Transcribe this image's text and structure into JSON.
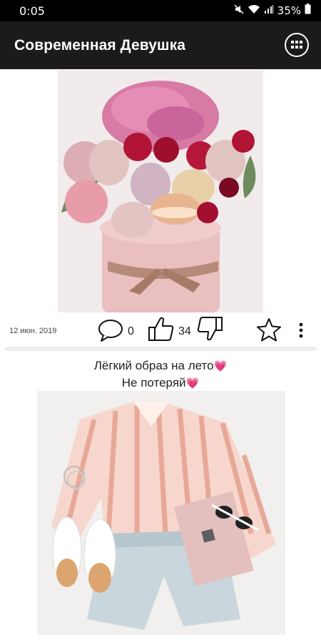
{
  "status_bar": {
    "time": "0:05",
    "battery": "35%"
  },
  "app_bar": {
    "title": "Современная Девушка",
    "menu_icon": "grid-menu-icon"
  },
  "posts": [
    {
      "date": "12 июн. 2019",
      "comments": "0",
      "likes": "34",
      "image": "flower-and-berry-bouquet-photo"
    },
    {
      "caption_line1": "Лёгкий образ на лето",
      "caption_line2": "Не потеряй",
      "emoji": "💗",
      "image": "summer-outfit-photo"
    }
  ],
  "colors": {
    "appbar": "#1b1b1b",
    "status_bar": "#000000",
    "emoji": "#ff1fa0"
  }
}
